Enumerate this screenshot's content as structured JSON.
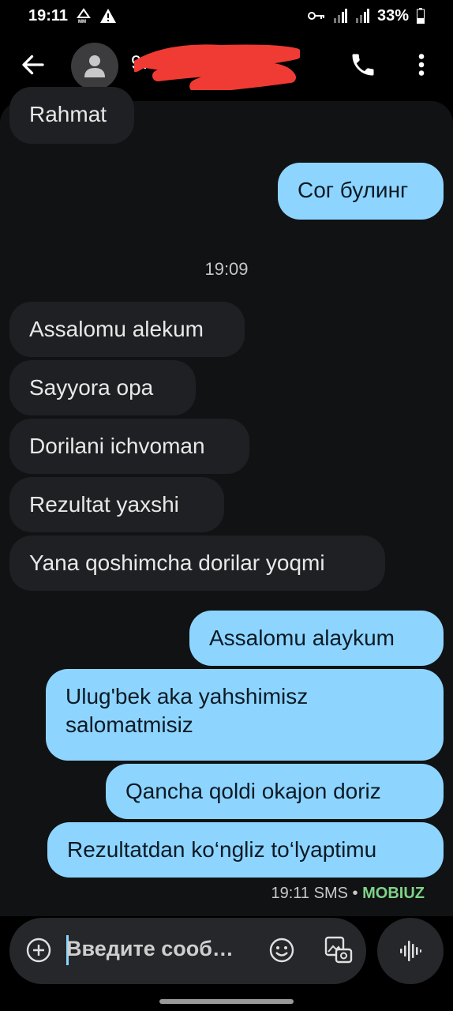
{
  "status_bar": {
    "time": "19:11",
    "battery": "33%",
    "icons": [
      "mm-network-icon",
      "warning-icon",
      "vpn-key-icon",
      "signal-icon",
      "signal-icon",
      "battery-icon"
    ]
  },
  "app_bar": {
    "contact_name": "9…",
    "icons": [
      "back-arrow-icon",
      "avatar-person-icon",
      "phone-icon",
      "more-vert-icon"
    ]
  },
  "messages": [
    {
      "dir": "in",
      "text": "Rahmat"
    },
    {
      "dir": "out",
      "text": "Сог булинг"
    },
    {
      "dir": "in",
      "text": "Assalomu alekum"
    },
    {
      "dir": "in",
      "text": "Sayyora opa"
    },
    {
      "dir": "in",
      "text": "Dorilani ichvoman"
    },
    {
      "dir": "in",
      "text": "Rezultat yaxshi"
    },
    {
      "dir": "in",
      "text": "Yana qoshimcha dorilar yoqmi"
    },
    {
      "dir": "out",
      "text": "Assalomu alaykum"
    },
    {
      "dir": "out",
      "line1": "Ulug'bek aka yahshimisz",
      "line2": "salomatmisiz"
    },
    {
      "dir": "out",
      "text": "Qancha qoldi okajon doriz"
    },
    {
      "dir": "out",
      "text": "Rezultatdan ko‘ngliz to‘lyaptimu"
    }
  ],
  "timestamp": "19:09",
  "last_meta": {
    "time": "19:11",
    "type": "SMS",
    "separator": "•",
    "carrier": "MOBIUZ"
  },
  "composer": {
    "placeholder": "Введите сооб…",
    "icons": [
      "add-circle-icon",
      "emoji-icon",
      "gallery-icon",
      "voice-waveform-icon"
    ]
  },
  "colors": {
    "incoming_bubble": "#1f2023",
    "outgoing_bubble": "#8dd5ff",
    "chat_background": "#111214",
    "carrier_accent": "#7ed287"
  }
}
